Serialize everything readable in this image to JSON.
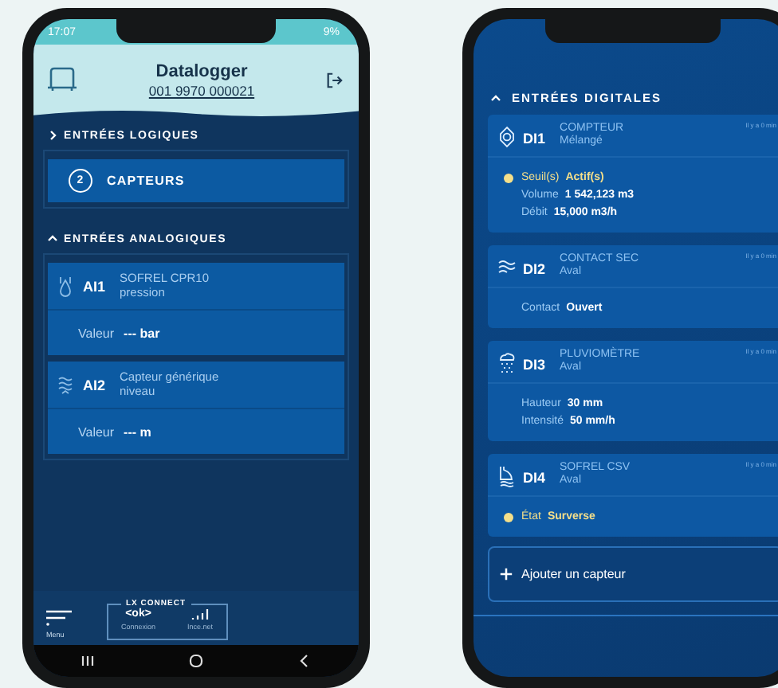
{
  "left_screen": {
    "status_bar": {
      "time": "17:07",
      "battery": "9%"
    },
    "header": {
      "title": "Datalogger",
      "serial": "001 9970 000021"
    },
    "sections": [
      {
        "title": "ENTRÉES LOGIQUES",
        "expanded": false,
        "button": {
          "count": "2",
          "label": "CAPTEURS"
        }
      },
      {
        "title": "ENTRÉES ANALOGIQUES",
        "expanded": true,
        "inputs": [
          {
            "id": "AI1",
            "kind": "pressure",
            "name": "SOFREL CPR10",
            "subtitle": "pression",
            "value_label": "Valeur",
            "value": "--- bar"
          },
          {
            "id": "AI2",
            "kind": "level",
            "name": "Capteur générique",
            "subtitle": "niveau",
            "value_label": "Valeur",
            "value": "--- m"
          }
        ]
      }
    ],
    "bottom_bar": {
      "menu": "Menu",
      "connect_title": "LX CONNECT",
      "connection_symbol": "<ok>",
      "connection_label": "Connexion",
      "network": "Ince.net"
    }
  },
  "right_screen": {
    "section": {
      "title": "ENTRÉES DIGITALES",
      "expanded": true
    },
    "inputs": [
      {
        "id": "DI1",
        "kind": "counter",
        "name": "COMPTEUR",
        "subtitle": "Mélangé",
        "time": "Il y a 0 min",
        "readings": [
          {
            "label": "Seuil(s)",
            "value": "Actif(s)",
            "alert": true
          },
          {
            "label": "Volume",
            "value": "1 542,123 m3",
            "alert": false
          },
          {
            "label": "Débit",
            "value": "15,000 m3/h",
            "alert": false
          }
        ]
      },
      {
        "id": "DI2",
        "kind": "contact",
        "name": "CONTACT SEC",
        "subtitle": "Aval",
        "time": "Il y a 0 min",
        "readings": [
          {
            "label": "Contact",
            "value": "Ouvert",
            "alert": false
          }
        ]
      },
      {
        "id": "DI3",
        "kind": "rain",
        "name": "PLUVIOMÈTRE",
        "subtitle": "Aval",
        "time": "Il y a 0 min",
        "readings": [
          {
            "label": "Hauteur",
            "value": "30 mm",
            "alert": false
          },
          {
            "label": "Intensité",
            "value": "50 mm/h",
            "alert": false
          }
        ]
      },
      {
        "id": "DI4",
        "kind": "overflow",
        "name": "SOFREL CSV",
        "subtitle": "Aval",
        "time": "Il y a 0 min",
        "readings": [
          {
            "label": "État",
            "value": "Surverse",
            "alert": true
          }
        ]
      }
    ],
    "add_button": {
      "label": "Ajouter un capteur"
    }
  }
}
